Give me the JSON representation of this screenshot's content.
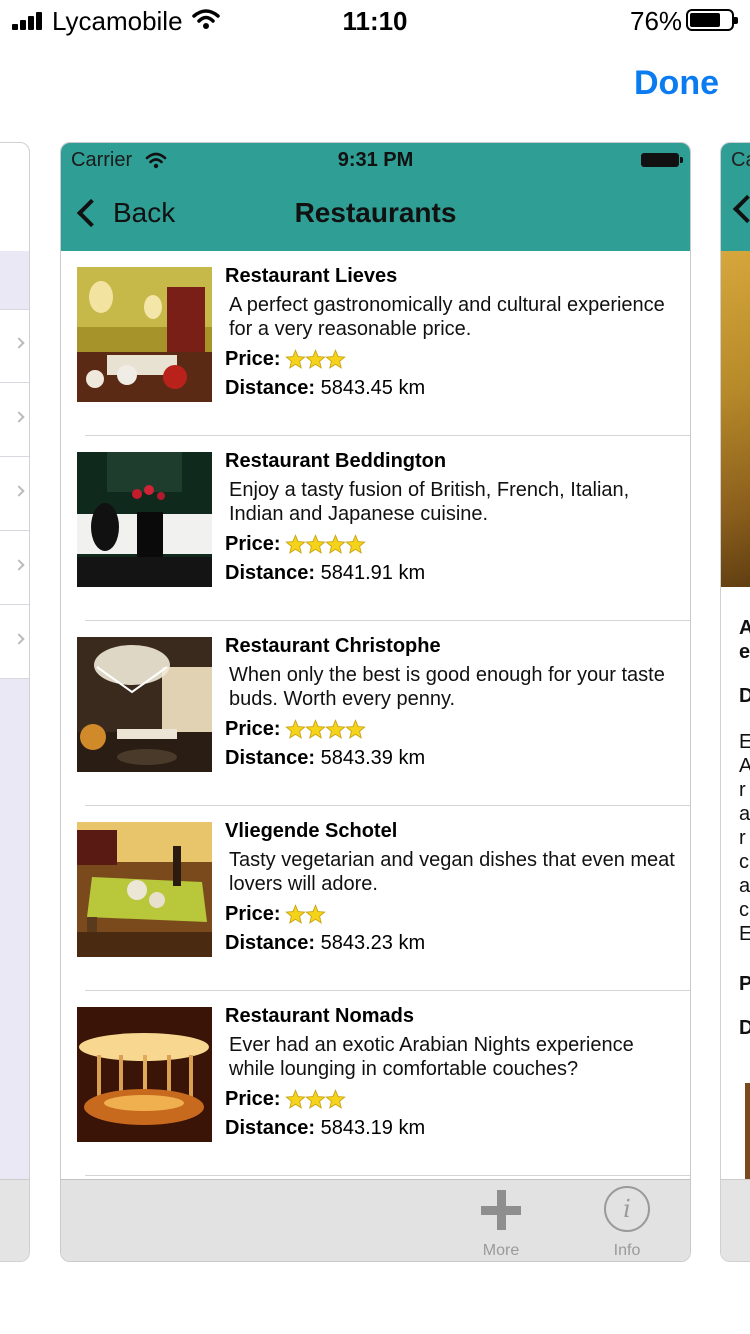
{
  "device_status": {
    "carrier": "Lycamobile",
    "time": "11:10",
    "battery_percent": "76%",
    "battery_level": 0.76
  },
  "done_label": "Done",
  "app": {
    "status": {
      "carrier": "Carrier",
      "time": "9:31 PM"
    },
    "nav": {
      "back_label": "Back",
      "title": "Restaurants"
    },
    "price_label": "Price:",
    "distance_label": "Distance:",
    "restaurants": [
      {
        "name": "Restaurant Lieves",
        "description": "A perfect gastronomically and cultural experience for a very reasonable price.",
        "price_stars": 3,
        "distance": "5843.45 km"
      },
      {
        "name": "Restaurant Beddington",
        "description": "Enjoy a tasty fusion of British, French, Italian, Indian and Japanese cuisine.",
        "price_stars": 4,
        "distance": "5841.91 km"
      },
      {
        "name": "Restaurant Christophe",
        "description": "When only the best is good enough for your taste buds. Worth every penny.",
        "price_stars": 4,
        "distance": "5843.39 km"
      },
      {
        "name": "Vliegende Schotel",
        "description": "Tasty vegetarian and vegan dishes that even meat lovers will adore.",
        "price_stars": 2,
        "distance": "5843.23 km"
      },
      {
        "name": "Restaurant Nomads",
        "description": "Ever had an exotic Arabian Nights experience while lounging in comfortable couches?",
        "price_stars": 3,
        "distance": "5843.19 km"
      }
    ],
    "tabs": {
      "more_label": "More",
      "info_label": "Info"
    }
  },
  "right_card": {
    "carrier_fragment": "Ca",
    "text_fragments_bold": [
      "A",
      "e",
      "D",
      "P",
      "D"
    ],
    "text_fragments": [
      "E",
      "A",
      "r",
      "a",
      "r",
      "c",
      "a",
      "c",
      "E"
    ]
  },
  "colors": {
    "nav_teal": "#2f9e94",
    "done_blue": "#0a7bf0",
    "star_yellow": "#f5d31a"
  }
}
